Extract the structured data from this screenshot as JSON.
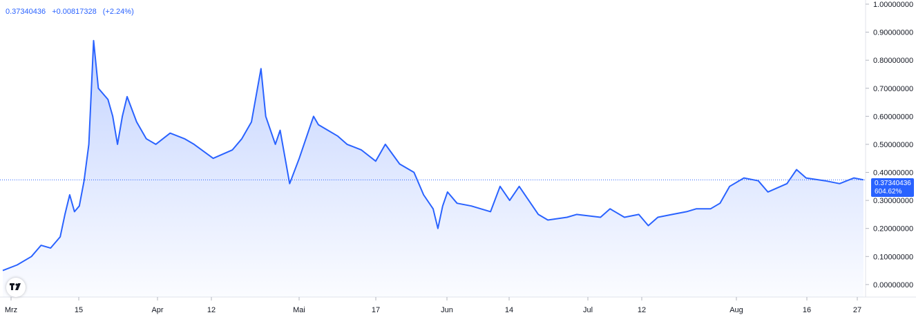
{
  "legend": {
    "price": "0.37340436",
    "change": "+0.00817328",
    "change_pct": "(+2.24%)"
  },
  "last_price_label": {
    "price": "0.37340436",
    "percent": "604.62%"
  },
  "colors": {
    "line": "#2962ff",
    "area_top": "#2962ff",
    "axis_text": "#131722",
    "price_label_bg": "#2962ff"
  },
  "logo": {
    "icon": "tradingview-logo-icon",
    "text": "17"
  },
  "chart_data": {
    "type": "area",
    "x_tick_labels": [
      "Mrz",
      "15",
      "Apr",
      "12",
      "Mai",
      "17",
      "Jun",
      "14",
      "Jul",
      "12",
      "Aug",
      "16",
      "27"
    ],
    "y_tick_labels": [
      "1.00000000",
      "0.90000000",
      "0.80000000",
      "0.70000000",
      "0.60000000",
      "0.50000000",
      "0.40000000",
      "0.30000000",
      "0.20000000",
      "0.10000000",
      "0.00000000"
    ],
    "ylim": [
      -0.02,
      1.0
    ],
    "x_axis_units": "day index from start of visible series",
    "grid": false,
    "legend": "top-left",
    "last_value_line": 0.3734,
    "x": [
      0,
      3,
      6,
      8,
      10,
      12,
      13,
      14,
      15,
      16,
      17,
      18,
      19,
      20,
      22,
      23,
      24,
      25,
      26,
      28,
      30,
      32,
      35,
      38,
      40,
      44,
      48,
      50,
      52,
      54,
      55,
      56,
      57,
      58,
      60,
      62,
      64,
      65,
      66,
      68,
      70,
      72,
      75,
      78,
      80,
      83,
      86,
      88,
      90,
      91,
      92,
      93,
      95,
      98,
      100,
      102,
      104,
      106,
      108,
      110,
      112,
      114,
      118,
      120,
      125,
      127,
      130,
      133,
      135,
      137,
      140,
      143,
      145,
      148,
      150,
      152,
      155,
      158,
      160,
      164,
      166,
      168,
      172,
      175,
      178,
      180
    ],
    "values": [
      0.05,
      0.07,
      0.1,
      0.14,
      0.13,
      0.17,
      0.25,
      0.32,
      0.26,
      0.28,
      0.37,
      0.5,
      0.87,
      0.7,
      0.66,
      0.6,
      0.5,
      0.6,
      0.67,
      0.58,
      0.52,
      0.5,
      0.54,
      0.52,
      0.5,
      0.45,
      0.48,
      0.52,
      0.58,
      0.77,
      0.6,
      0.55,
      0.5,
      0.55,
      0.36,
      0.45,
      0.55,
      0.6,
      0.57,
      0.55,
      0.53,
      0.5,
      0.48,
      0.44,
      0.5,
      0.43,
      0.4,
      0.32,
      0.27,
      0.2,
      0.28,
      0.33,
      0.29,
      0.28,
      0.27,
      0.26,
      0.35,
      0.3,
      0.35,
      0.3,
      0.25,
      0.23,
      0.24,
      0.25,
      0.24,
      0.27,
      0.24,
      0.25,
      0.21,
      0.24,
      0.25,
      0.26,
      0.27,
      0.27,
      0.29,
      0.35,
      0.38,
      0.37,
      0.33,
      0.36,
      0.41,
      0.38,
      0.37,
      0.36,
      0.38,
      0.3734
    ]
  }
}
